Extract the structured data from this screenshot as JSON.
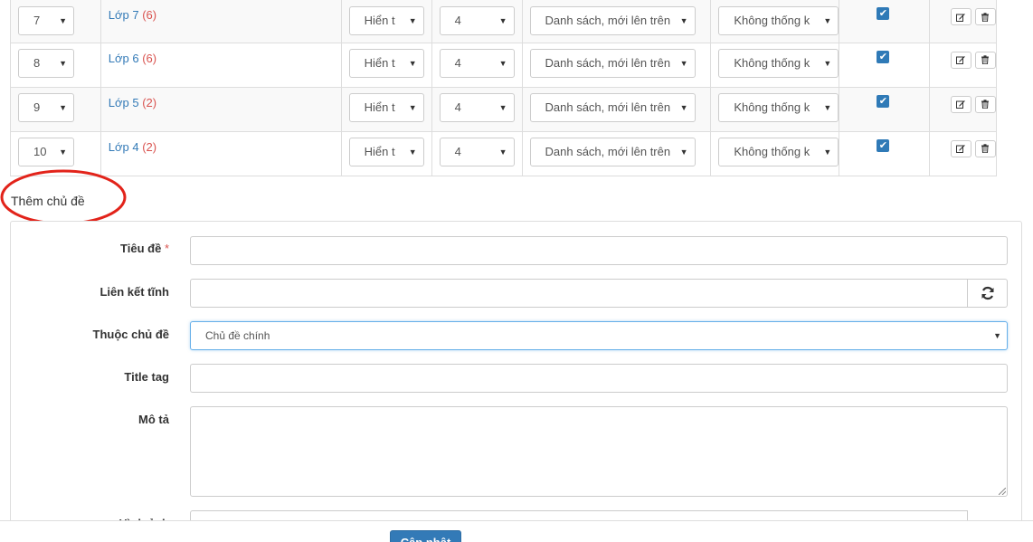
{
  "table": {
    "rows": [
      {
        "weight": "7",
        "title": "Lớp 7",
        "count": "(6)",
        "show": "Hiển t",
        "num": "4",
        "view": "Danh sách, mới lên trên",
        "stat": "Không thống k",
        "checked": true
      },
      {
        "weight": "8",
        "title": "Lớp 6",
        "count": "(6)",
        "show": "Hiển t",
        "num": "4",
        "view": "Danh sách, mới lên trên",
        "stat": "Không thống k",
        "checked": true
      },
      {
        "weight": "9",
        "title": "Lớp 5",
        "count": "(2)",
        "show": "Hiển t",
        "num": "4",
        "view": "Danh sách, mới lên trên",
        "stat": "Không thống k",
        "checked": true
      },
      {
        "weight": "10",
        "title": "Lớp 4",
        "count": "(2)",
        "show": "Hiển t",
        "num": "4",
        "view": "Danh sách, mới lên trên",
        "stat": "Không thống k",
        "checked": true
      }
    ],
    "icons": {
      "check": "checkbox-checked-icon",
      "edit": "edit-icon",
      "delete": "trash-icon",
      "dropdown": "caret-down-icon"
    }
  },
  "add_section": {
    "heading": "Thêm chủ đề",
    "annotation_color": "#e2231a"
  },
  "form": {
    "title_label": "Tiêu đề",
    "required_mark": "*",
    "alias_label": "Liên kết tĩnh",
    "alias_button_icon": "refresh-icon",
    "parent_label": "Thuộc chủ đề",
    "parent_value": "Chủ đề chính",
    "title_tag_label": "Title tag",
    "description_label": "Mô tả",
    "image_label": "Hình ảnh",
    "submit_label": "Cập nhật"
  },
  "colors": {
    "link": "#337ab7",
    "count": "#d9534f",
    "primary": "#337ab7",
    "checkbox": "#2f7ab7"
  }
}
